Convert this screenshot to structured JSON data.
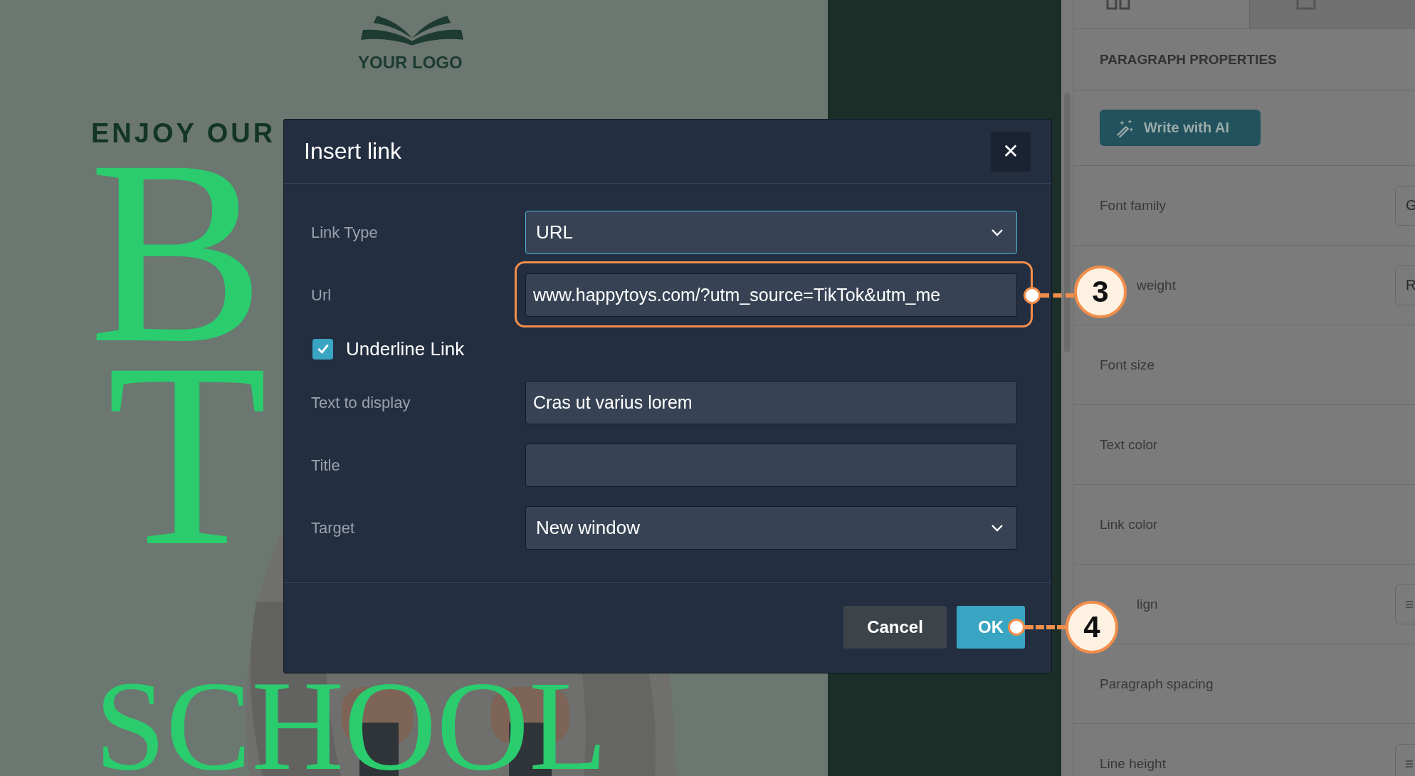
{
  "poster": {
    "logo_text": "YOUR LOGO",
    "tagline": "ENJOY OUR",
    "headline": [
      "B",
      "T",
      "SCHOOL"
    ]
  },
  "properties_panel": {
    "tabs": [
      {
        "selected": true
      },
      {
        "selected": false
      }
    ],
    "section_title": "PARAGRAPH PROPERTIES",
    "ai_button": "Write with AI",
    "rows": [
      {
        "label": "Font family",
        "kind": "field",
        "value": "G",
        "partly_hidden": false
      },
      {
        "label": "weight",
        "kind": "field",
        "value": "R",
        "partly_hidden": true
      },
      {
        "label": "Font size",
        "kind": "plain",
        "partly_hidden": false
      },
      {
        "label": "Text color",
        "kind": "plain",
        "partly_hidden": false
      },
      {
        "label": "Link color",
        "kind": "plain",
        "partly_hidden": false
      },
      {
        "label": "lign",
        "kind": "icon-field",
        "partly_hidden": true
      },
      {
        "label": "Paragraph spacing",
        "kind": "plain",
        "partly_hidden": false
      },
      {
        "label": "Line height",
        "kind": "icon-field",
        "partly_hidden": false
      }
    ]
  },
  "dialog": {
    "title": "Insert link",
    "close": "✕",
    "fields": [
      {
        "label": "Link Type",
        "kind": "select",
        "value": "URL",
        "focused": true
      },
      {
        "label": "Url",
        "kind": "text",
        "value": "www.happytoys.com/?utm_source=TikTok&utm_me",
        "focused": false,
        "callout": "3"
      },
      {
        "label": "Underline Link",
        "kind": "checkbox",
        "checked": true
      },
      {
        "label": "Text to display",
        "kind": "text",
        "value": "Cras ut varius lorem",
        "focused": false
      },
      {
        "label": "Title",
        "kind": "text",
        "focused": false
      },
      {
        "label": "Target",
        "kind": "select",
        "value": "New window",
        "focused": false
      }
    ],
    "buttons": [
      {
        "label": "Cancel",
        "kind": "secondary"
      },
      {
        "label": "OK",
        "kind": "primary",
        "callout": "4"
      }
    ]
  }
}
